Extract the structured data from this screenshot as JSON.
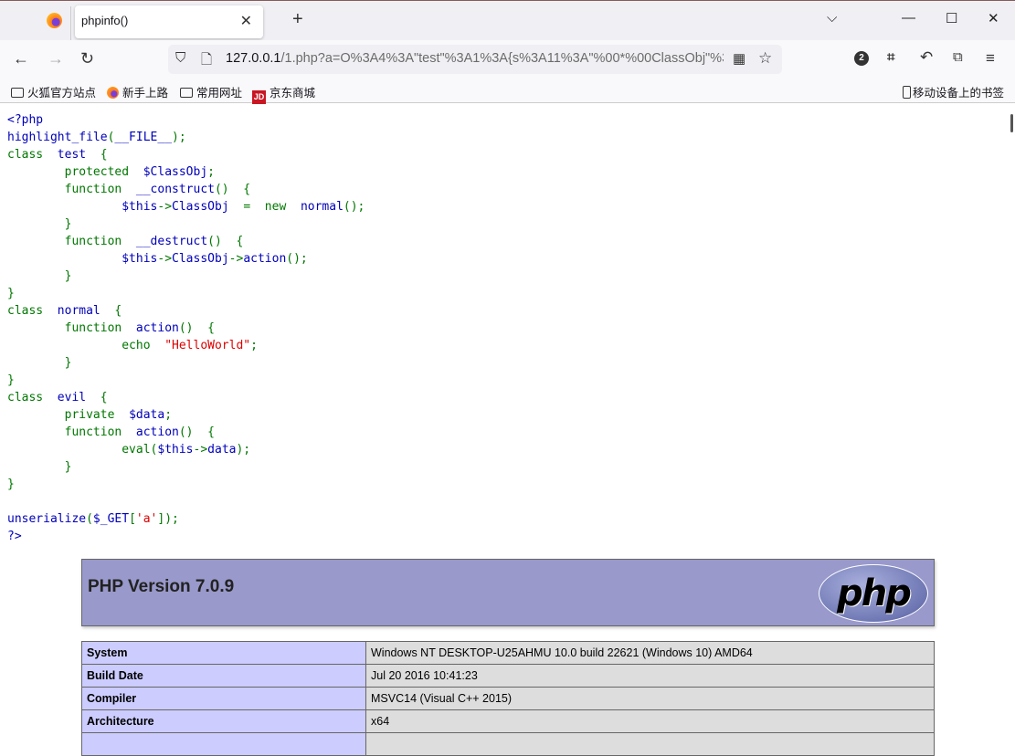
{
  "browser": {
    "tab_title": "phpinfo()",
    "url_host": "127.0.0.1",
    "url_rest": "/1.php?a=O%3A4%3A\"test\"%3A1%3A{s%3A11%3A\"%00*%00ClassObj\"%3",
    "extensions_badge": "2",
    "bookmarks": [
      "火狐官方站点",
      "新手上路",
      "常用网址",
      "京东商城"
    ],
    "mobile_bookmarks": "移动设备上的书签",
    "jd_logo": "JD"
  },
  "code_lines": [
    [
      [
        "<?php",
        "b"
      ]
    ],
    [
      [
        "highlight_file",
        "b"
      ],
      [
        "(",
        "g"
      ],
      [
        "__FILE__",
        "b"
      ],
      [
        ");",
        "g"
      ]
    ],
    [
      [
        "class  ",
        "g"
      ],
      [
        "test  ",
        "b"
      ],
      [
        "{",
        "g"
      ]
    ],
    [
      [
        "        protected  ",
        "g"
      ],
      [
        "$ClassObj",
        "b"
      ],
      [
        ";",
        "g"
      ]
    ],
    [
      [
        "        function  ",
        "g"
      ],
      [
        "__construct",
        "b"
      ],
      [
        "()  {",
        "g"
      ]
    ],
    [
      [
        "                ",
        "g"
      ],
      [
        "$this",
        "b"
      ],
      [
        "->",
        "g"
      ],
      [
        "ClassObj  ",
        "b"
      ],
      [
        "=  new  ",
        "g"
      ],
      [
        "normal",
        "b"
      ],
      [
        "();",
        "g"
      ]
    ],
    [
      [
        "        }",
        "g"
      ]
    ],
    [
      [
        "        function  ",
        "g"
      ],
      [
        "__destruct",
        "b"
      ],
      [
        "()  {",
        "g"
      ]
    ],
    [
      [
        "                ",
        "g"
      ],
      [
        "$this",
        "b"
      ],
      [
        "->",
        "g"
      ],
      [
        "ClassObj",
        "b"
      ],
      [
        "->",
        "g"
      ],
      [
        "action",
        "b"
      ],
      [
        "();",
        "g"
      ]
    ],
    [
      [
        "        }",
        "g"
      ]
    ],
    [
      [
        "}",
        "g"
      ]
    ],
    [
      [
        "class  ",
        "g"
      ],
      [
        "normal  ",
        "b"
      ],
      [
        "{",
        "g"
      ]
    ],
    [
      [
        "        function  ",
        "g"
      ],
      [
        "action",
        "b"
      ],
      [
        "()  {",
        "g"
      ]
    ],
    [
      [
        "                echo  ",
        "g"
      ],
      [
        "\"HelloWorld\"",
        "r"
      ],
      [
        ";",
        "g"
      ]
    ],
    [
      [
        "        }",
        "g"
      ]
    ],
    [
      [
        "}",
        "g"
      ]
    ],
    [
      [
        "class  ",
        "g"
      ],
      [
        "evil  ",
        "b"
      ],
      [
        "{",
        "g"
      ]
    ],
    [
      [
        "        private  ",
        "g"
      ],
      [
        "$data",
        "b"
      ],
      [
        ";",
        "g"
      ]
    ],
    [
      [
        "        function  ",
        "g"
      ],
      [
        "action",
        "b"
      ],
      [
        "()  {",
        "g"
      ]
    ],
    [
      [
        "                eval(",
        "g"
      ],
      [
        "$this",
        "b"
      ],
      [
        "->",
        "g"
      ],
      [
        "data",
        "b"
      ],
      [
        ");",
        "g"
      ]
    ],
    [
      [
        "        }",
        "g"
      ]
    ],
    [
      [
        "}",
        "g"
      ]
    ],
    [
      [
        "",
        ""
      ]
    ],
    [
      [
        "unserialize",
        "b"
      ],
      [
        "(",
        "g"
      ],
      [
        "$_GET",
        "b"
      ],
      [
        "[",
        "g"
      ],
      [
        "'a'",
        "r"
      ],
      [
        "]);",
        "g"
      ]
    ],
    [
      [
        "?>",
        "b"
      ]
    ]
  ],
  "phpinfo": {
    "title": "PHP Version 7.0.9",
    "logo_text": "php",
    "rows": [
      {
        "key": "System",
        "value": "Windows NT DESKTOP-U25AHMU 10.0 build 22621 (Windows 10) AMD64"
      },
      {
        "key": "Build Date",
        "value": "Jul 20 2016 10:41:23"
      },
      {
        "key": "Compiler",
        "value": "MSVC14 (Visual C++ 2015)"
      },
      {
        "key": "Architecture",
        "value": "x64"
      },
      {
        "key": "",
        "value": ""
      }
    ]
  }
}
